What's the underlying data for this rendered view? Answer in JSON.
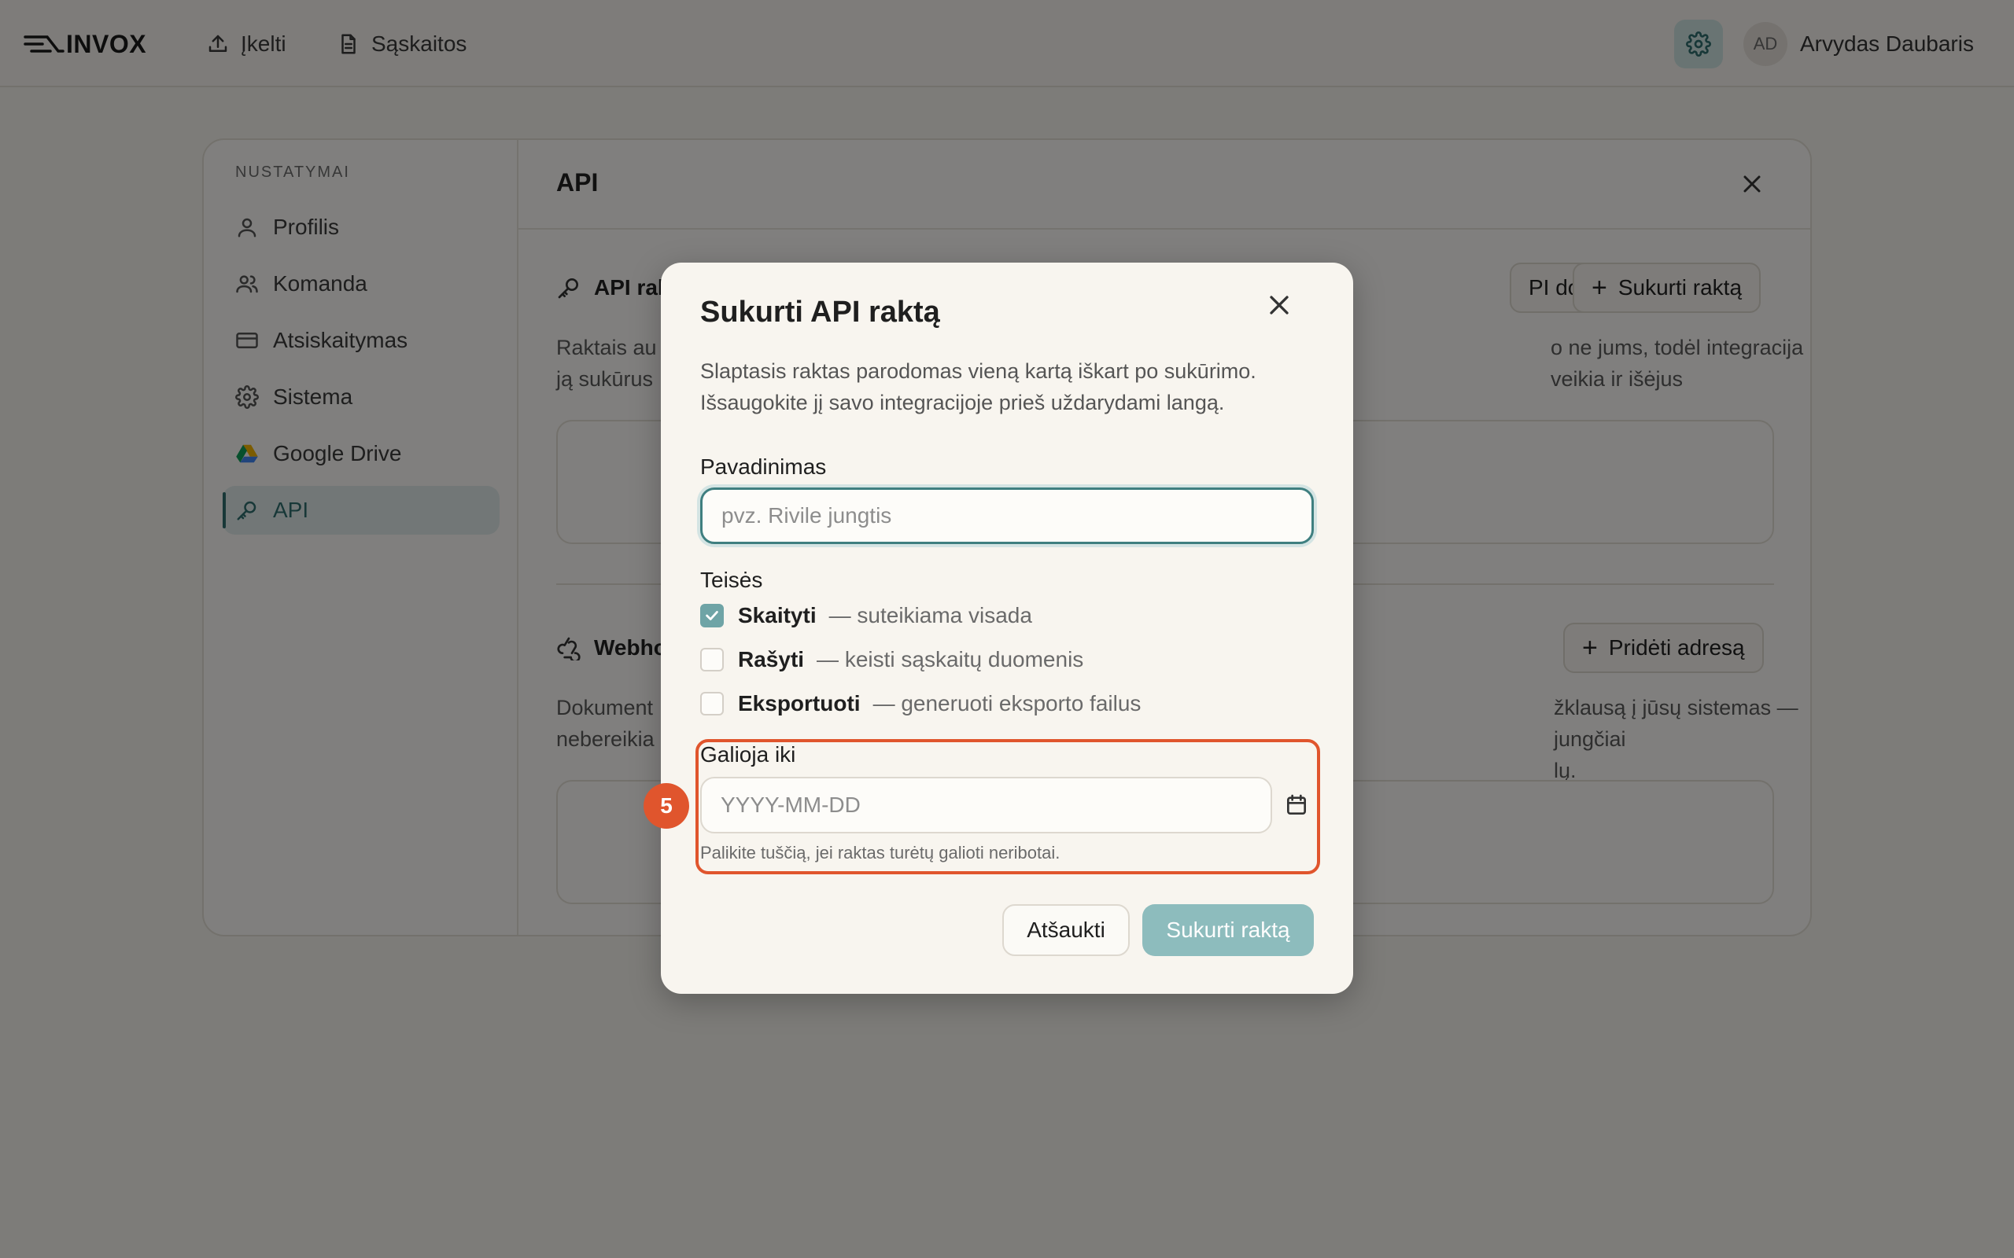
{
  "app": {
    "name": "INVOX"
  },
  "topnav": {
    "upload": "Įkelti",
    "invoices": "Sąskaitos"
  },
  "user": {
    "initials": "AD",
    "name": "Arvydas Daubaris"
  },
  "sidebar": {
    "title": "NUSTATYMAI",
    "items": [
      {
        "label": "Profilis",
        "icon": "user-icon"
      },
      {
        "label": "Komanda",
        "icon": "team-icon"
      },
      {
        "label": "Atsiskaitymas",
        "icon": "credit-card-icon"
      },
      {
        "label": "Sistema",
        "icon": "gear-icon"
      },
      {
        "label": "Google Drive",
        "icon": "google-drive-icon"
      },
      {
        "label": "API",
        "icon": "key-icon",
        "active": true
      }
    ]
  },
  "content": {
    "title": "API",
    "api_keys": {
      "heading": "API rak",
      "docs_button": "PI dokumentacija",
      "create_button": "Sukurti raktą",
      "text_left_1": "Raktais au",
      "text_left_2": "ją sukūrus",
      "text_right_1": "o ne jums, todėl integracija veikia ir išėjus"
    },
    "webhooks": {
      "heading": "Webho",
      "add_button": "Pridėti adresą",
      "text_left_1": "Dokument",
      "text_left_2": "nebereikia",
      "text_right_1": "žklausą į jūsų sistemas — jungčiai",
      "text_right_2": "lų."
    }
  },
  "dialog": {
    "title": "Sukurti API raktą",
    "description": "Slaptasis raktas parodomas vieną kartą iškart po sukūrimo. Išsaugokite jį savo integracijoje prieš uždarydami langą.",
    "name_label": "Pavadinimas",
    "name_placeholder": "pvz. Rivile jungtis",
    "name_value": "",
    "permissions_label": "Teisės",
    "permissions": [
      {
        "name": "Skaityti",
        "desc": "— suteikiama visada",
        "checked": true
      },
      {
        "name": "Rašyti",
        "desc": "— keisti sąskaitų duomenis",
        "checked": false
      },
      {
        "name": "Eksportuoti",
        "desc": "— generuoti eksporto failus",
        "checked": false
      }
    ],
    "expiry_label": "Galioja iki",
    "expiry_placeholder": "YYYY-MM-DD",
    "expiry_hint": "Palikite tuščią, jei raktas turėtų galioti neribotai.",
    "cancel": "Atšaukti",
    "submit": "Sukurti raktą",
    "step_badge": "5"
  },
  "colors": {
    "accent": "#3f7f80",
    "highlight": "#e0552d",
    "submit_disabled": "#8dbcbd"
  }
}
